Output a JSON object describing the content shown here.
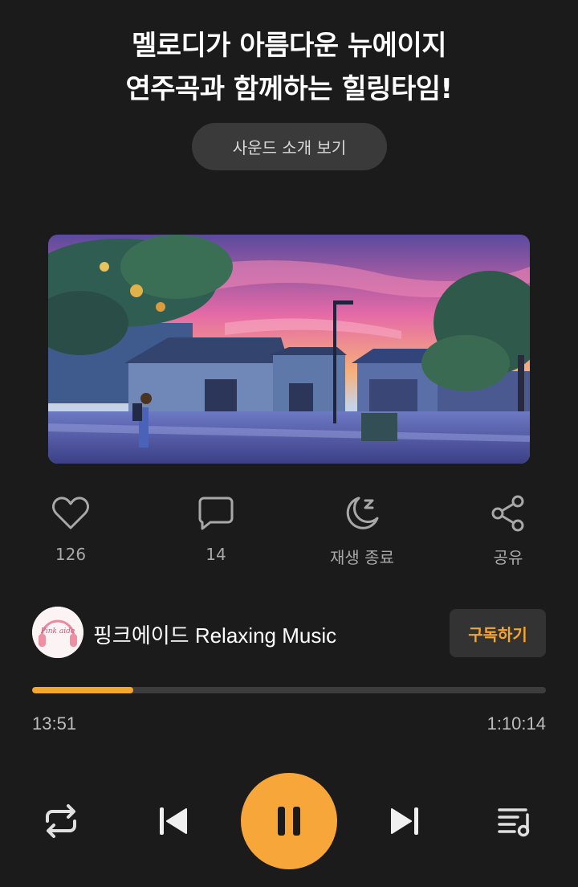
{
  "header": {
    "title_line1": "멜로디가 아름다운 뉴에이지",
    "title_line2": "연주곡과 함께하는 힐링타임!",
    "intro_button": "사운드 소개 보기"
  },
  "actions": {
    "like": {
      "icon": "heart-icon",
      "count": "126"
    },
    "comment": {
      "icon": "comment-icon",
      "count": "14"
    },
    "sleep": {
      "icon": "moon-sleep-icon",
      "label": "재생 종료"
    },
    "share": {
      "icon": "share-icon",
      "label": "공유"
    }
  },
  "channel": {
    "name": "핑크에이드 Relaxing Music",
    "avatar_text": "Pink aide",
    "subscribe_label": "구독하기"
  },
  "player": {
    "elapsed": "13:51",
    "duration": "1:10:14",
    "progress": 0.197,
    "controls": [
      "repeat-icon",
      "previous-icon",
      "pause-icon",
      "next-icon",
      "playlist-icon"
    ]
  },
  "colors": {
    "background": "#1b1b1b",
    "accent": "#f5a631",
    "button_bg": "#3a3a3a"
  }
}
